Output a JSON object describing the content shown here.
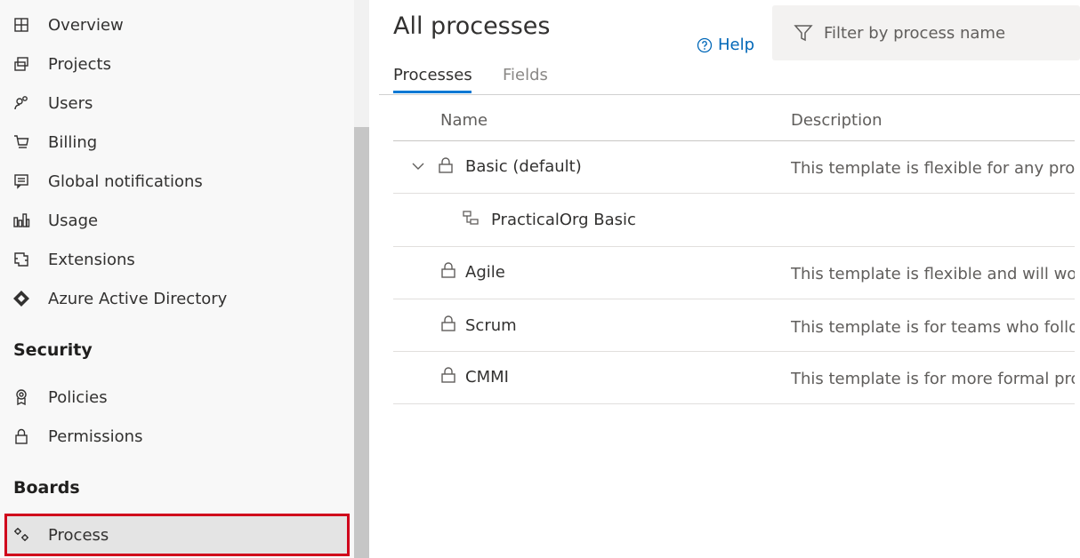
{
  "sidebar": {
    "items": [
      {
        "label": "Overview",
        "icon": "overview-icon"
      },
      {
        "label": "Projects",
        "icon": "projects-icon"
      },
      {
        "label": "Users",
        "icon": "users-icon"
      },
      {
        "label": "Billing",
        "icon": "cart-icon"
      },
      {
        "label": "Global notifications",
        "icon": "notification-icon"
      },
      {
        "label": "Usage",
        "icon": "usage-icon"
      },
      {
        "label": "Extensions",
        "icon": "extensions-icon"
      },
      {
        "label": "Azure Active Directory",
        "icon": "azure-ad-icon"
      }
    ],
    "security": {
      "title": "Security",
      "items": [
        {
          "label": "Policies",
          "icon": "policy-icon"
        },
        {
          "label": "Permissions",
          "icon": "lock-icon"
        }
      ]
    },
    "boards": {
      "title": "Boards",
      "items": [
        {
          "label": "Process",
          "icon": "process-icon",
          "selected": true
        }
      ]
    }
  },
  "main": {
    "title": "All processes",
    "help_label": "Help",
    "filter": {
      "placeholder": "Filter by process name",
      "value": ""
    },
    "tabs": [
      {
        "label": "Processes",
        "active": true
      },
      {
        "label": "Fields",
        "active": false
      }
    ],
    "table": {
      "columns": [
        "Name",
        "Description"
      ],
      "rows": [
        {
          "name": "Basic (default)",
          "description": "This template is flexible for any process",
          "expanded": true,
          "locked": true
        },
        {
          "name": "PracticalOrg Basic",
          "description": "",
          "inherited": true
        },
        {
          "name": "Agile",
          "description": "This template is flexible and will work",
          "locked": true
        },
        {
          "name": "Scrum",
          "description": "This template is for teams who follow",
          "locked": true
        },
        {
          "name": "CMMI",
          "description": "This template is for more formal projects",
          "locked": true
        }
      ]
    }
  },
  "colors": {
    "accent": "#0078d4",
    "link": "#0067b8",
    "highlight_border": "#d0021b",
    "sidebar_bg": "#f8f8f8"
  }
}
